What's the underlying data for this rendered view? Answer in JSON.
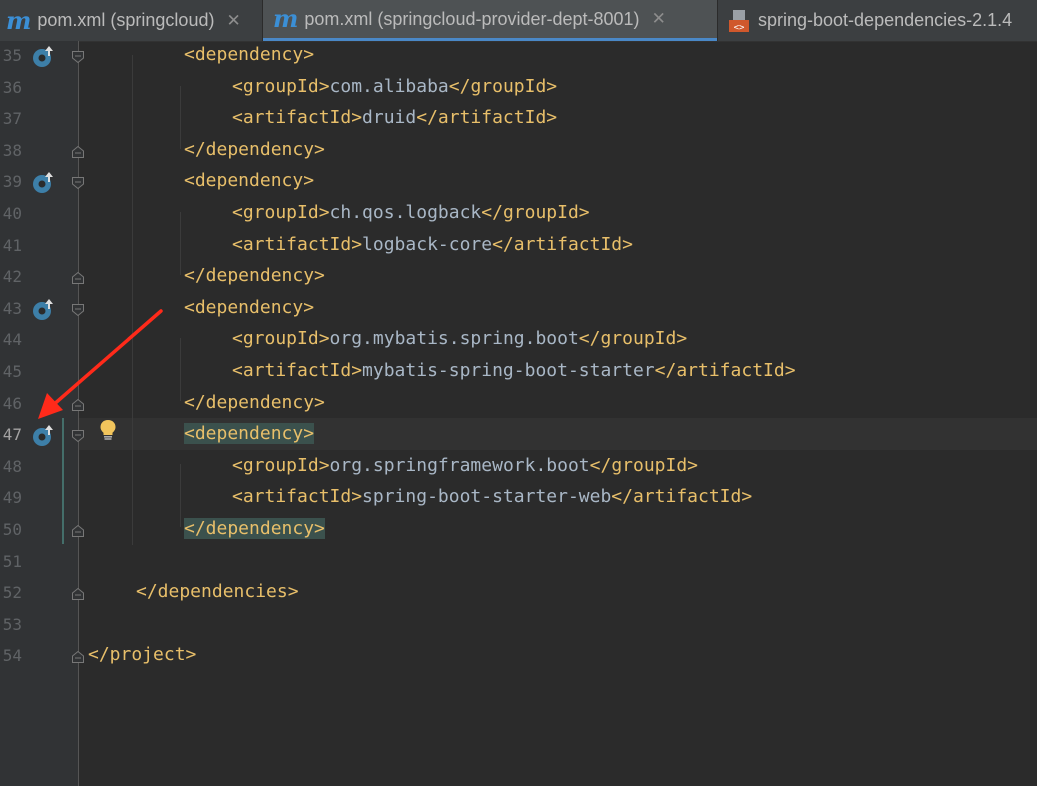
{
  "tabs": [
    {
      "label": "pom.xml (springcloud)",
      "icon": "maven-icon",
      "active": false,
      "closable": true
    },
    {
      "label": "pom.xml (springcloud-provider-dept-8001)",
      "icon": "maven-icon",
      "active": true,
      "closable": true
    },
    {
      "label": "spring-boot-dependencies-2.1.4",
      "icon": "dependency-pom-icon",
      "active": false,
      "closable": false
    }
  ],
  "tab_icon_glyph": "m",
  "close_glyph": "✕",
  "colors": {
    "tag": "#e8bf6a",
    "text": "#a9b7c6",
    "background": "#2b2b2b",
    "gutter": "#313335",
    "match_highlight": "#3b514d",
    "arrow": "#ff2a1a"
  },
  "lines": [
    {
      "n": "35",
      "indent": 8,
      "tag_open": "<dependency>",
      "text": "",
      "tag_close": "",
      "marker": true
    },
    {
      "n": "36",
      "indent": 12,
      "tag_open": "<groupId>",
      "text": "com.alibaba",
      "tag_close": "</groupId>"
    },
    {
      "n": "37",
      "indent": 12,
      "tag_open": "<artifactId>",
      "text": "druid",
      "tag_close": "</artifactId>"
    },
    {
      "n": "38",
      "indent": 8,
      "tag_open": "</dependency>",
      "text": "",
      "tag_close": ""
    },
    {
      "n": "39",
      "indent": 8,
      "tag_open": "<dependency>",
      "text": "",
      "tag_close": "",
      "marker": true
    },
    {
      "n": "40",
      "indent": 12,
      "tag_open": "<groupId>",
      "text": "ch.qos.logback",
      "tag_close": "</groupId>"
    },
    {
      "n": "41",
      "indent": 12,
      "tag_open": "<artifactId>",
      "text": "logback-core",
      "tag_close": "</artifactId>"
    },
    {
      "n": "42",
      "indent": 8,
      "tag_open": "</dependency>",
      "text": "",
      "tag_close": ""
    },
    {
      "n": "43",
      "indent": 8,
      "tag_open": "<dependency>",
      "text": "",
      "tag_close": "",
      "marker": true
    },
    {
      "n": "44",
      "indent": 12,
      "tag_open": "<groupId>",
      "text": "org.mybatis.spring.boot",
      "tag_close": "</groupId>"
    },
    {
      "n": "45",
      "indent": 12,
      "tag_open": "<artifactId>",
      "text": "mybatis-spring-boot-starter",
      "tag_close": "</artifactId>"
    },
    {
      "n": "46",
      "indent": 8,
      "tag_open": "</dependency>",
      "text": "",
      "tag_close": ""
    },
    {
      "n": "47",
      "indent": 8,
      "tag_open": "<dependency>",
      "text": "",
      "tag_close": "",
      "marker": true,
      "highlight": true,
      "current": true
    },
    {
      "n": "48",
      "indent": 12,
      "tag_open": "<groupId>",
      "text": "org.springframework.boot",
      "tag_close": "</groupId>"
    },
    {
      "n": "49",
      "indent": 12,
      "tag_open": "<artifactId>",
      "text": "spring-boot-starter-web",
      "tag_close": "</artifactId>"
    },
    {
      "n": "50",
      "indent": 8,
      "tag_open": "</dependency>",
      "text": "",
      "tag_close": "",
      "highlight": true
    },
    {
      "n": "51",
      "indent": 0,
      "tag_open": "",
      "text": "",
      "tag_close": ""
    },
    {
      "n": "52",
      "indent": 4,
      "tag_open": "</dependencies>",
      "text": "",
      "tag_close": ""
    },
    {
      "n": "53",
      "indent": 0,
      "tag_open": "",
      "text": "",
      "tag_close": ""
    },
    {
      "n": "54",
      "indent": 0,
      "tag_open": "</project>",
      "text": "",
      "tag_close": ""
    }
  ]
}
